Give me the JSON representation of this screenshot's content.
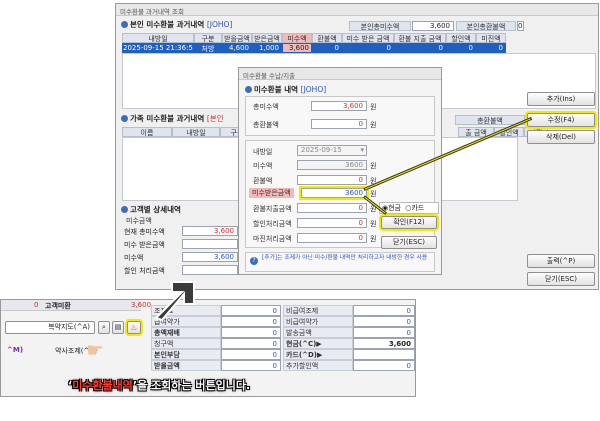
{
  "main_window": {
    "title": "미수환불 과거내역 조회",
    "section1_title": "본인 미수환불 과거내역",
    "section1_tag": "[JOHO]",
    "summary": {
      "label1": "본인총미수액",
      "value1": "3,600",
      "label2": "본인총환불액",
      "value2": "0"
    },
    "table1": {
      "headers": [
        "내방일",
        "구분",
        "받을금액",
        "받은금액",
        "미수액",
        "환불액",
        "미수 받은 금액",
        "환불 지출 금액",
        "할인액",
        "미진액"
      ],
      "row": [
        "2025-09-15 21:36:50",
        "처방",
        "4,600",
        "1,000",
        "3,600",
        "0",
        "0",
        "0",
        "0",
        "0"
      ]
    },
    "section2_title": "가족 미수환불 과거내역",
    "section2_tag": "[본인",
    "table2_headers": [
      "이름",
      "내방일",
      "구분",
      "출 금액",
      "할인액",
      "미진"
    ],
    "family_total_label": "총환불액",
    "section3_title": "고객별 상세내역",
    "group_label": "미수금액",
    "details": [
      {
        "label": "현재 총미수액",
        "value": "3,600"
      },
      {
        "label": "미수 받은금액",
        "value": ""
      },
      {
        "label": "미수액",
        "value": "3,600"
      },
      {
        "label": "할인 처리금액",
        "value": ""
      }
    ],
    "buttons": {
      "add": "추가(Ins)",
      "edit": "수정(F4)",
      "delete": "삭제(Del)",
      "print": "출력(^P)",
      "close": "닫기(ESC)"
    }
  },
  "dialog": {
    "title": "미수환불 수납/지출",
    "section_title": "미수환불 내역",
    "section_tag": "[JOHO]",
    "total_unpaid_label": "총미수액",
    "total_unpaid_value": "3,600",
    "total_refund_label": "총환불액",
    "total_refund_value": "0",
    "unit": "원",
    "visit_date_label": "내방일",
    "visit_date_value": "2025-09-15",
    "unpaid_label": "미수액",
    "unpaid_value": "3600",
    "refund_label": "환불액",
    "refund_value": "0",
    "received_label": "미수받은금액",
    "received_value": "3600",
    "refund_out_label": "환불지출금액",
    "refund_out_value": "0",
    "discount_label": "할인처리금액",
    "discount_value": "0",
    "balance_label": "마진처리금액",
    "balance_value": "0",
    "pay_cash": "현금",
    "pay_card": "카드",
    "ok_button": "확인(F12)",
    "close_button": "닫기(ESC)",
    "note": "[추가]는 조제가 아닌 미수/환불 내역만 처리하고자 내방한 경우 사용"
  },
  "bottom_window": {
    "customer_label": "고객미환",
    "customer_num": "0",
    "top_amount": "3,600",
    "dropdown_button": "복약지도(^A)",
    "side_label": "^M)",
    "side_label2": "약사조제(^N)",
    "rows": [
      {
        "left": "조제료",
        "left_val": "0",
        "right": "비급여조제",
        "right_val": "0"
      },
      {
        "left": "급여약가",
        "left_val": "0",
        "right": "비급여약가",
        "right_val": "0"
      },
      {
        "left": "총액재배",
        "left_val": "0",
        "right": "발송금액",
        "right_val": "0"
      },
      {
        "left": "청구액",
        "left_val": "0",
        "right": "현금(^C)▶",
        "right_val": "3,600"
      },
      {
        "left": "본인부담",
        "left_val": "0",
        "right": "카드(^D)▶",
        "right_val": ""
      },
      {
        "left": "받을금액",
        "left_val": "0",
        "right": "추가할인액",
        "right_val": "0"
      }
    ]
  },
  "caption": {
    "quote_open": "‘",
    "highlight": "미수환불내역",
    "rest": "’을 조회하는 버튼입니다."
  }
}
